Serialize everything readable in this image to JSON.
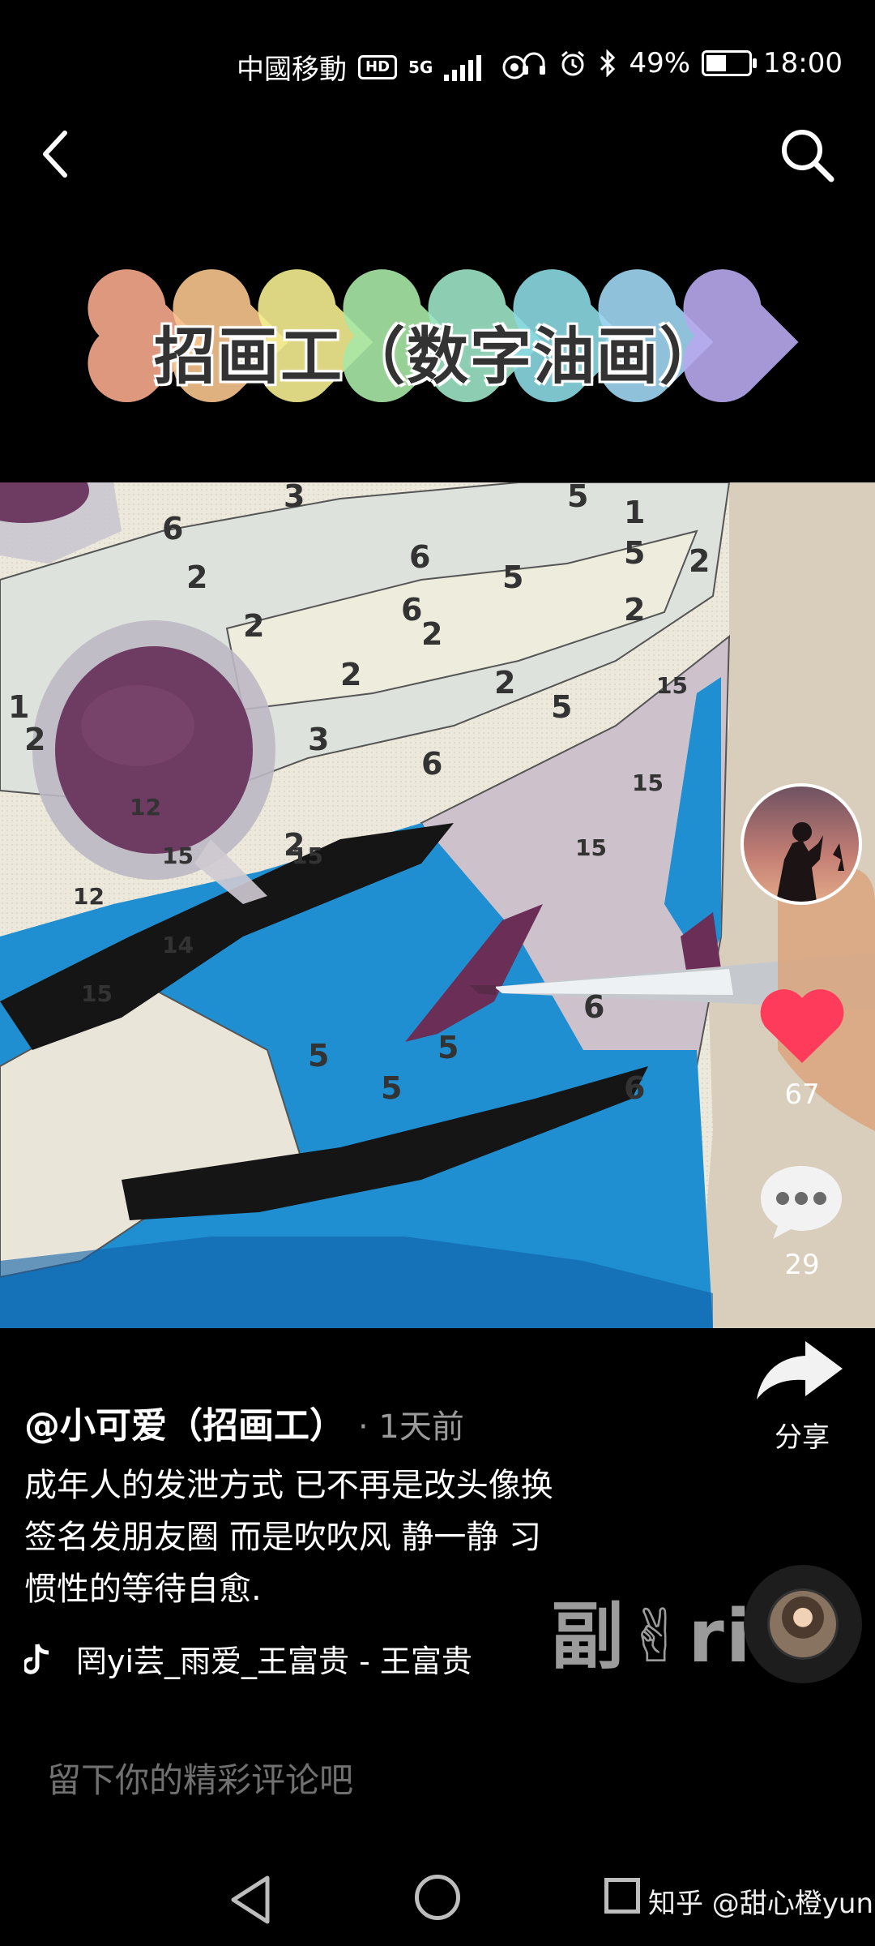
{
  "status_bar": {
    "carrier": "中國移動",
    "hd": "HD",
    "network": "5G",
    "battery": "49%",
    "time": "18:00"
  },
  "title_banner": {
    "text": "招画工（数字油画）"
  },
  "painting_numbers": [
    "3",
    "6",
    "2",
    "6",
    "2",
    "6",
    "5",
    "5",
    "1",
    "5",
    "2",
    "2",
    "2",
    "2",
    "5",
    "2",
    "6",
    "3",
    "2",
    "15",
    "15",
    "15",
    "12",
    "15",
    "15",
    "12",
    "14",
    "15",
    "6",
    "5",
    "5",
    "5",
    "6",
    "1",
    "2"
  ],
  "actions": {
    "like_count": "67",
    "comment_count": "29",
    "share_label": "分享"
  },
  "post": {
    "author": "@小可爱（招画工）",
    "time": "· 1天前",
    "caption_lines": [
      "成年人的发泄方式 已不再是改头像换",
      "签名发朋友圈 而是吹吹风 静一静 习",
      "惯性的等待自愈."
    ],
    "music": "罔yi芸_雨爱_王富贵 - 王富贵",
    "music_watermark": "副✌ri"
  },
  "comment": {
    "placeholder": "留下你的精彩评论吧"
  },
  "watermark": "知乎 @甜心橙yun",
  "colors": {
    "like": "#ff3b5c",
    "heart_colors": [
      "#f6a98c",
      "#f8c58d",
      "#f4ee91",
      "#a9e8a6",
      "#9de5c6",
      "#8ad9e3",
      "#9fd6f2",
      "#b8a9ef"
    ]
  }
}
